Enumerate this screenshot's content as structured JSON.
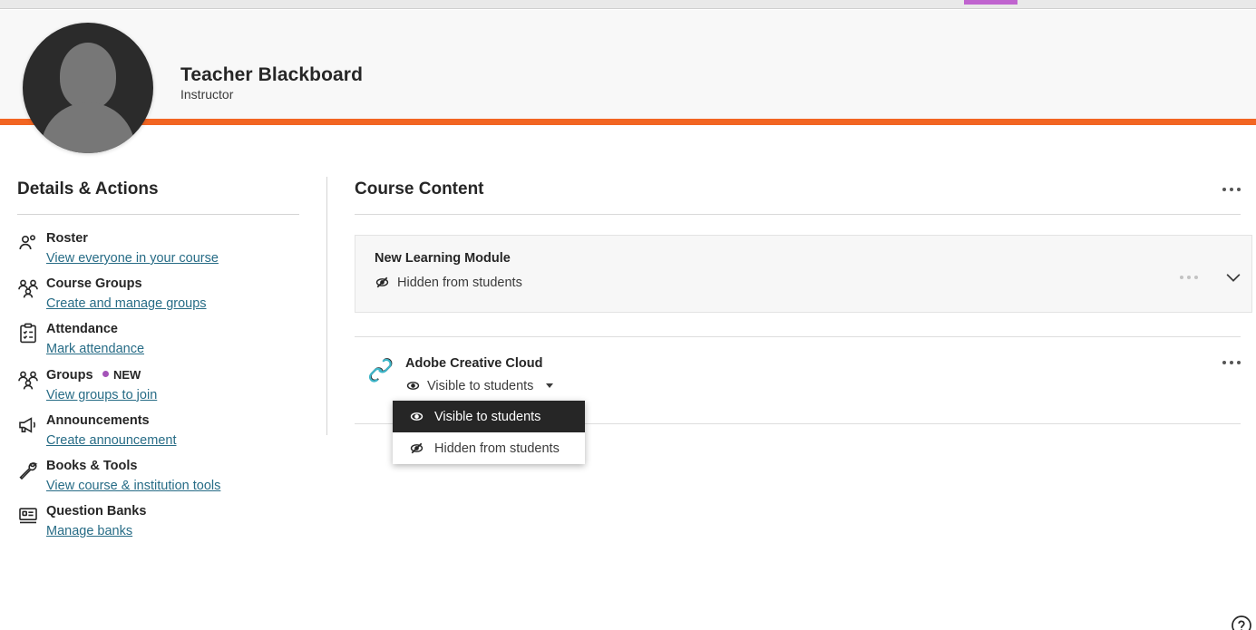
{
  "colors": {
    "accent_orange": "#f26522",
    "link_teal": "#276c86",
    "badge_purple": "#a453b8",
    "selected_dark": "#262626",
    "tab_indicator": "#c064cf"
  },
  "browser": {
    "tab_indicator_label": "active-tab-indicator"
  },
  "profile": {
    "name": "Teacher Blackboard",
    "role": "Instructor",
    "avatar_alt": "avatar"
  },
  "sidebar": {
    "title": "Details & Actions",
    "items": [
      {
        "icon": "roster-icon",
        "label": "Roster",
        "link": "View everyone in your course"
      },
      {
        "icon": "course-groups-icon",
        "label": "Course Groups",
        "link": "Create and manage groups"
      },
      {
        "icon": "attendance-icon",
        "label": "Attendance",
        "link": "Mark attendance"
      },
      {
        "icon": "groups-icon",
        "label": "Groups",
        "link": "View groups to join",
        "badge": "NEW"
      },
      {
        "icon": "announcements-icon",
        "label": "Announcements",
        "link": "Create announcement"
      },
      {
        "icon": "books-tools-icon",
        "label": "Books & Tools",
        "link": "View course & institution tools"
      },
      {
        "icon": "question-banks-icon",
        "label": "Question Banks",
        "link": "Manage banks"
      }
    ]
  },
  "main": {
    "title": "Course Content",
    "overflow_label": "more-options",
    "module": {
      "title": "New Learning Module",
      "status": "Hidden from students",
      "status_icon": "eye-slash-icon",
      "overflow_label": "more-options",
      "expand_label": "expand"
    },
    "link_item": {
      "icon": "chain-link-icon",
      "title": "Adobe Creative Cloud",
      "visibility": "Visible to students",
      "visibility_icon": "eye-icon",
      "overflow_label": "more-options"
    },
    "visibility_dropdown": {
      "options": [
        {
          "label": "Visible to students",
          "icon": "eye-icon",
          "selected": true
        },
        {
          "label": "Hidden from students",
          "icon": "eye-slash-icon",
          "selected": false
        }
      ]
    }
  },
  "footer": {
    "help_label": "help"
  }
}
